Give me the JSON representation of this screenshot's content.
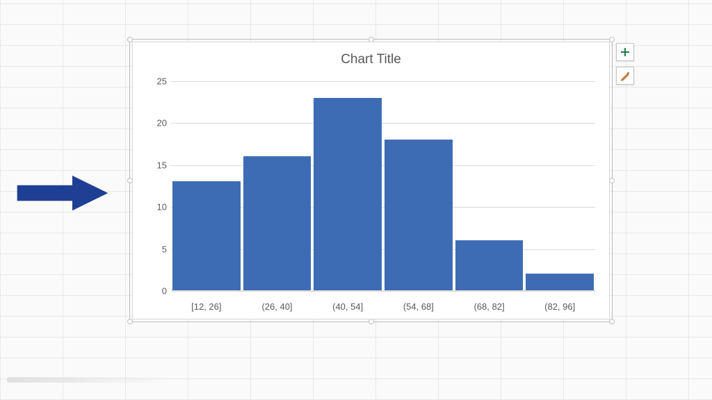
{
  "chart_data": {
    "type": "bar",
    "title": "Chart Title",
    "categories": [
      "[12, 26]",
      "(26, 40]",
      "(40, 54]",
      "(54, 68]",
      "(68, 82]",
      "(82, 96]"
    ],
    "values": [
      13,
      16,
      23,
      18,
      6,
      2
    ],
    "y_ticks": [
      "0",
      "5",
      "10",
      "15",
      "20",
      "25"
    ],
    "ylim": [
      0,
      25
    ],
    "xlabel": "",
    "ylabel": "",
    "bar_color": "#3d6cb4"
  },
  "buttons": {
    "chart_elements": "+",
    "chart_styles": "brush"
  }
}
